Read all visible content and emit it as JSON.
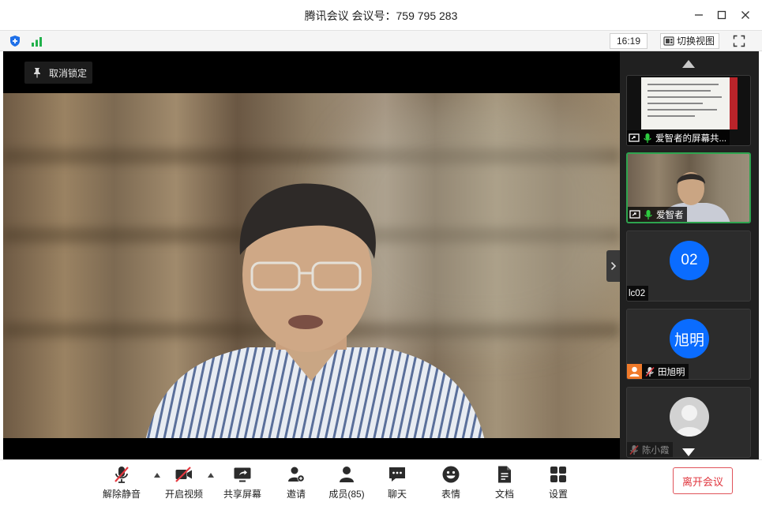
{
  "window": {
    "title": "腾讯会议 会议号：759 795 283"
  },
  "statusbar": {
    "time": "16:19",
    "switch_view_label": "切换视图"
  },
  "main_video": {
    "unpin_label": "取消锁定"
  },
  "participants": [
    {
      "name": "爱智者的屏幕共...",
      "type": "screen-share",
      "mic": "on",
      "active": false
    },
    {
      "name": "爱智者",
      "type": "camera",
      "mic": "on",
      "active": true
    },
    {
      "name": "lc02",
      "type": "avatar",
      "avatar_text": "02",
      "mic": "none",
      "active": false
    },
    {
      "name": "田旭明",
      "type": "avatar",
      "avatar_text": "旭明",
      "mic": "muted",
      "active": false
    },
    {
      "name": "陈小霞",
      "type": "default-avatar",
      "mic": "muted",
      "active": false
    }
  ],
  "toolbar": {
    "unmute_label": "解除静音",
    "video_label": "开启视频",
    "share_label": "共享屏幕",
    "invite_label": "邀请",
    "members_label": "成员(85)",
    "chat_label": "聊天",
    "emoji_label": "表情",
    "docs_label": "文档",
    "settings_label": "设置",
    "leave_label": "离开会议"
  },
  "colors": {
    "accent_blue": "#0a6cff",
    "active_green": "#2ea44f",
    "leave_red": "#e0353d",
    "mute_red": "#e5383f"
  }
}
